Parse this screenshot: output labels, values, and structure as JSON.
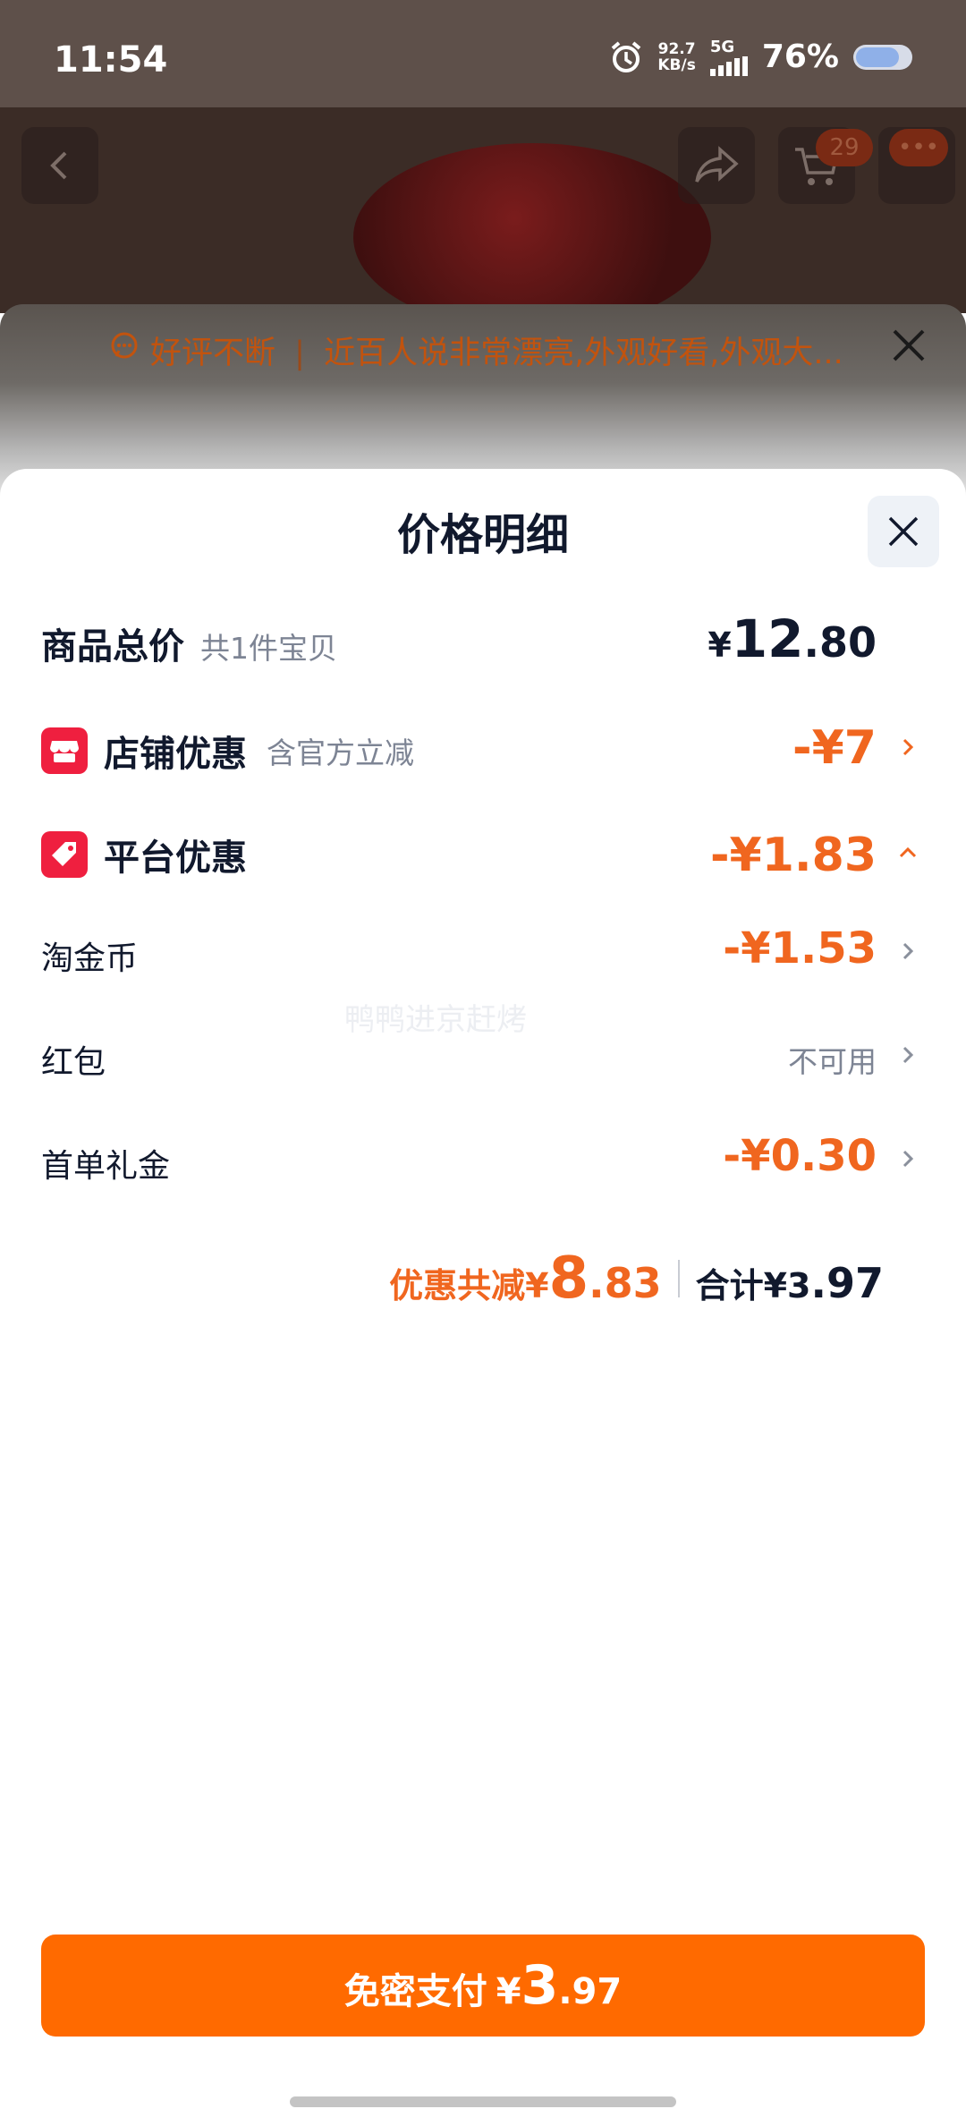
{
  "status_bar": {
    "time": "11:54",
    "net_speed_value": "92.7",
    "net_speed_unit": "KB/s",
    "signal": "5G",
    "battery": "76%"
  },
  "product_page": {
    "cart_count": "29"
  },
  "review_banner": {
    "tag": "好评不断",
    "text": "近百人说非常漂亮,外观好看,外观大..."
  },
  "sheet": {
    "title": "价格明细",
    "total_row": {
      "label": "商品总价",
      "sub": "共1件宝贝",
      "currency": "¥",
      "int": "12",
      "dec": ".80"
    },
    "shop_discount": {
      "label": "店铺优惠",
      "sub": "含官方立减",
      "value": "-¥7"
    },
    "platform_discount": {
      "label": "平台优惠",
      "value": "-¥1.83"
    },
    "items": [
      {
        "label": "淘金币",
        "value": "-¥1.53"
      },
      {
        "label": "红包",
        "value": "不可用"
      },
      {
        "label": "首单礼金",
        "value": "-¥0.30"
      }
    ],
    "summary": {
      "discount_label": "优惠共减¥",
      "discount_int": "8",
      "discount_dec": ".83",
      "total_label": "合计¥",
      "total_int": "3",
      "total_dec": ".97"
    },
    "watermark": "鸭鸭进京赶烤"
  },
  "pay_button": {
    "label": "免密支付",
    "currency": "¥",
    "int": "3",
    "dec": ".97"
  },
  "colors": {
    "accent": "#ff6a00",
    "discount": "#f0661f",
    "badge_red": "#ef1f3f"
  }
}
